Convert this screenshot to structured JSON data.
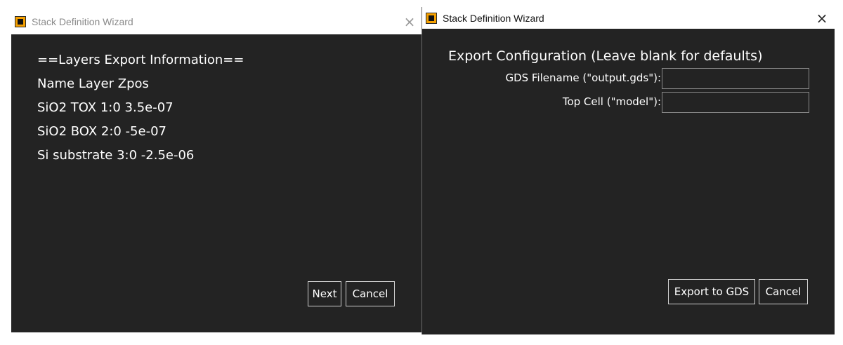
{
  "windows": {
    "left": {
      "title": "Stack Definition Wizard",
      "close_glyph": "×",
      "lines": [
        "==Layers Export Information==",
        "Name Layer Zpos",
        "SiO2 TOX 1:0 3.5e-07",
        "SiO2 BOX 2:0 -5e-07",
        "Si substrate 3:0 -2.5e-06"
      ],
      "buttons": {
        "next": "Next",
        "cancel": "Cancel"
      }
    },
    "right": {
      "title": "Stack Definition Wizard",
      "close_glyph": "×",
      "heading": "Export Configuration (Leave blank for defaults)",
      "fields": {
        "gds_filename": {
          "label": "GDS Filename (\"output.gds\"):",
          "value": ""
        },
        "top_cell": {
          "label": "Top Cell (\"model\"):",
          "value": ""
        }
      },
      "buttons": {
        "export": "Export to GDS",
        "cancel": "Cancel"
      }
    }
  },
  "colors": {
    "window_background": "#232323",
    "titlebar_background": "#ffffff",
    "app_icon_accent": "#f5a000",
    "text": "#ffffff",
    "inactive_title_text": "#8a8a8a"
  },
  "icons": {
    "app_icon": "app-icon",
    "close": "close-icon"
  }
}
